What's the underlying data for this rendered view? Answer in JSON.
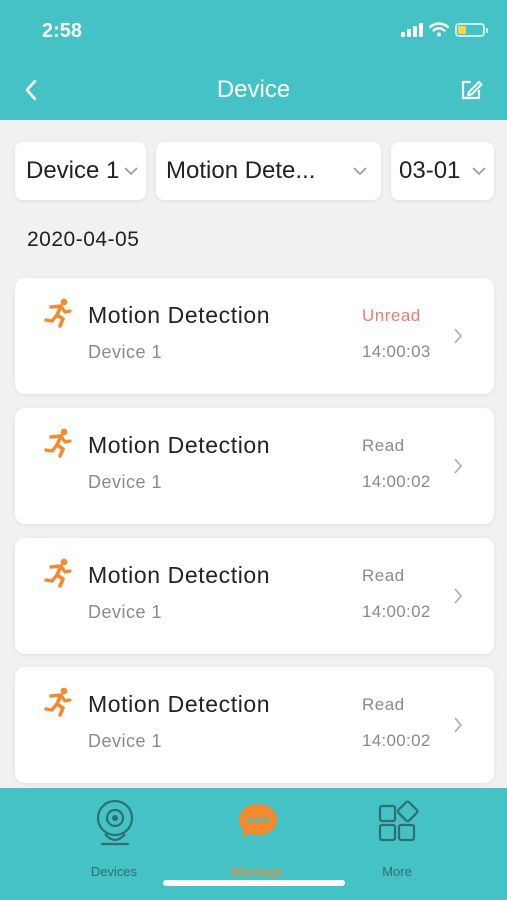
{
  "status_bar": {
    "time": "2:58"
  },
  "nav": {
    "title": "Device",
    "back_icon": "chevron-left-icon",
    "edit_icon": "edit-icon"
  },
  "filters": [
    {
      "value": "Device 1"
    },
    {
      "value": "Motion Dete..."
    },
    {
      "value": "03-01"
    }
  ],
  "date_header": "2020-04-05",
  "messages": [
    {
      "title": "Motion Detection",
      "device": "Device 1",
      "status": "Unread",
      "time": "14:00:03"
    },
    {
      "title": "Motion Detection",
      "device": "Device 1",
      "status": "Read",
      "time": "14:00:02"
    },
    {
      "title": "Motion Detection",
      "device": "Device 1",
      "status": "Read",
      "time": "14:00:02"
    },
    {
      "title": "Motion Detection",
      "device": "Device 1",
      "status": "Read",
      "time": "14:00:02"
    }
  ],
  "tabs": [
    {
      "label": "Devices",
      "icon": "camera-icon",
      "active": false
    },
    {
      "label": "Message",
      "icon": "message-icon",
      "active": true
    },
    {
      "label": "More",
      "icon": "grid-icon",
      "active": false
    }
  ],
  "colors": {
    "brand": "#44c2c5",
    "accent": "#f28a2e",
    "unread": "#f07a72"
  }
}
